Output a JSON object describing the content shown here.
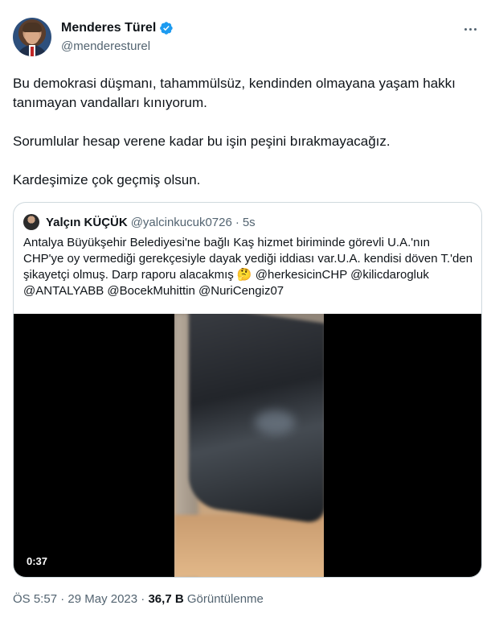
{
  "author": {
    "name": "Menderes Türel",
    "handle": "@menderesturel",
    "verified": true,
    "verified_color": "#1d9bf0"
  },
  "tweet": {
    "paragraphs": [
      "Bu demokrasi düşmanı, tahammülsüz, kendinden olmayana yaşam hakkı tanımayan vandalları kınıyorum.",
      "Sorumlular hesap verene kadar bu işin peşini bırakmayacağız.",
      "Kardeşimize çok geçmiş olsun."
    ]
  },
  "quote": {
    "name": "Yalçın KÜÇÜK",
    "handle": "@yalcinkucuk0726",
    "separator": "·",
    "time": "5s",
    "text": "Antalya Büyükşehir Belediyesi'ne bağlı Kaş hizmet biriminde görevli U.A.'nın CHP'ye oy vermediği gerekçesiyle dayak yediği iddiası var.U.A. kendisi döven T.'den şikayetçi olmuş. Darp raporu alacakmış 🤔 @herkesicinCHP @kilicdarogluk @ANTALYABB @BocekMuhittin @NuriCengiz07",
    "video_duration": "0:37"
  },
  "meta": {
    "time": "ÖS 5:57",
    "sep1": "·",
    "date": "29 May 2023",
    "sep2": "·",
    "views_count": "36,7 B",
    "views_label": "Görüntülenme"
  },
  "icons": {
    "more": "more-horizontal-icon",
    "verified": "verified-badge-icon"
  }
}
